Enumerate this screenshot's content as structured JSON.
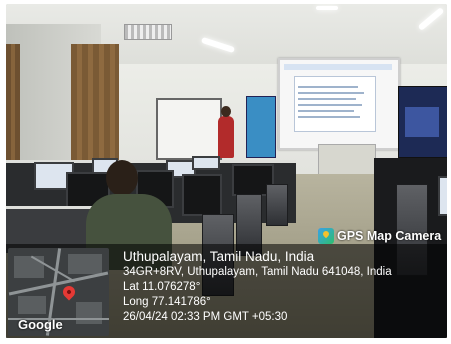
{
  "app_badge": {
    "label": "GPS Map Camera",
    "icon": "gps-map-camera-icon"
  },
  "location": {
    "title": "Uthupalayam, Tamil Nadu, India",
    "address": "34GR+8RV, Uthupalayam, Tamil Nadu 641048, India",
    "latitude": "Lat 11.076278°",
    "longitude": "Long 77.141786°",
    "datetime": "26/04/24 02:33 PM GMT +05:30"
  },
  "map": {
    "provider_logo": "Google",
    "pin_icon": "map-pin-icon"
  },
  "colors": {
    "overlay": "#000000",
    "pin": "#e53935",
    "text": "#ffffff"
  }
}
